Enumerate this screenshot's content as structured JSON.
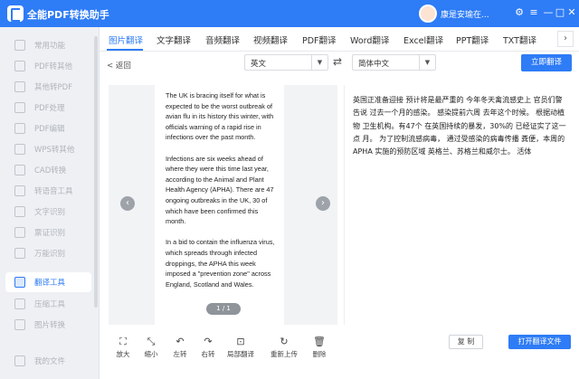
{
  "app": {
    "title": "全能PDF转换助手",
    "user_name": "康是安瑜在...",
    "controls": {
      "settings": "⚙",
      "menu": "≡",
      "minimize": "—",
      "maximize": "□",
      "close": "✕"
    }
  },
  "sidebar": {
    "items": [
      {
        "label": "常用功能",
        "active": false
      },
      {
        "label": "PDF转其他",
        "active": false
      },
      {
        "label": "其他转PDF",
        "active": false
      },
      {
        "label": "PDF处理",
        "active": false
      },
      {
        "label": "PDF编辑",
        "active": false
      },
      {
        "label": "WPS转其他",
        "active": false
      },
      {
        "label": "CAD转换",
        "active": false
      },
      {
        "label": "转语音工具",
        "active": false
      },
      {
        "label": "文字识别",
        "active": false
      },
      {
        "label": "票证识别",
        "active": false
      },
      {
        "label": "万能识别",
        "active": false
      },
      {
        "label": "翻译工具",
        "active": true
      },
      {
        "label": "压缩工具",
        "active": false
      },
      {
        "label": "图片转换",
        "active": false
      },
      {
        "label": "我的文件",
        "active": false
      }
    ]
  },
  "tabs": [
    {
      "label": "图片翻译",
      "active": true
    },
    {
      "label": "文字翻译",
      "active": false
    },
    {
      "label": "音频翻译",
      "active": false
    },
    {
      "label": "视频翻译",
      "active": false
    },
    {
      "label": "PDF翻译",
      "active": false
    },
    {
      "label": "Word翻译",
      "active": false
    },
    {
      "label": "Excel翻译",
      "active": false
    },
    {
      "label": "PPT翻译",
      "active": false
    },
    {
      "label": "TXT翻译",
      "active": false
    }
  ],
  "tab_more": "›",
  "back_label": "< 返回",
  "source_lang": "英文",
  "target_lang": "简体中文",
  "dropdown_arrow": "▼",
  "swap_glyph": "⇄",
  "translate_now_label": "立即翻译",
  "source_paragraphs": [
    "The UK is bracing itself for what is expected to be the worst outbreak of avian flu in its history this winter, with officials warning of a rapid rise in infections over the past month.",
    "Infections are six weeks ahead of where they were this time last year, according to the Animal and Plant Health Agency (APHA). There are 47 ongoing outbreaks in the UK, 30 of which have been confirmed this month.",
    "In a bid to contain the influenza virus, which spreads through infected droppings, the APHA this week imposed a \"prevention zone\" across England, Scotland and Wales."
  ],
  "page_indicator": "1 / 1",
  "nav_prev": "‹",
  "nav_next": "›",
  "translated_text": "英国正准备迎接 预计将是最严重的 今年冬天禽流感史上 官员们警告说 过去一个月的感染。 感染提前六周 去年这个时候。 根据动植物 卫生机构。有47个 在英国持续的暴发，30%的 已经证实了这一点 月。 为了控制流感病毒， 通过受感染的病毒传播 粪便，本周的APHA 实施的预防区域 英格兰、苏格兰和威尔士。 活体",
  "toolbar": [
    {
      "label": "放大",
      "icon": "⛶"
    },
    {
      "label": "缩小",
      "icon": "⤡"
    },
    {
      "label": "左转",
      "icon": "↶"
    },
    {
      "label": "右转",
      "icon": "↷"
    },
    {
      "label": "局部翻译",
      "icon": "⊡"
    },
    {
      "label": "重新上传",
      "icon": "↻"
    },
    {
      "label": "删除",
      "icon": "🗑"
    }
  ],
  "copy_label": "复 制",
  "open_translation_label": "打开翻译文件"
}
